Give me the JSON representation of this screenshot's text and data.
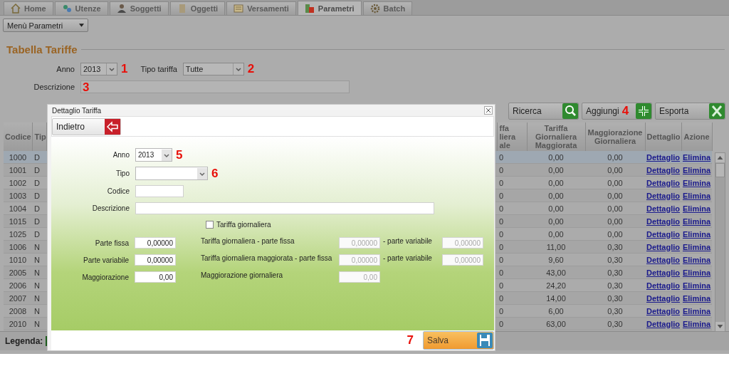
{
  "tabs": [
    {
      "label": "Home",
      "selected": false
    },
    {
      "label": "Utenze",
      "selected": false
    },
    {
      "label": "Soggetti",
      "selected": false
    },
    {
      "label": "Oggetti",
      "selected": false
    },
    {
      "label": "Versamenti",
      "selected": false
    },
    {
      "label": "Parametri",
      "selected": true
    },
    {
      "label": "Batch",
      "selected": false
    }
  ],
  "menu": {
    "value": "Menù Parametri"
  },
  "page_title": "Tabella Tariffe",
  "filters": {
    "anno": {
      "label": "Anno",
      "value": "2013",
      "marker": "1"
    },
    "tipo": {
      "label": "Tipo tariffa",
      "value": "Tutte",
      "marker": "2"
    },
    "descrizione": {
      "label": "Descrizione",
      "marker": "3"
    }
  },
  "actions": [
    {
      "label": "Ricerca",
      "kind": "search"
    },
    {
      "label": "Aggiungi",
      "kind": "add",
      "marker": "4"
    },
    {
      "label": "Esporta",
      "kind": "excel"
    }
  ],
  "table": {
    "columns": [
      "Codice",
      "Tip",
      "ffa liera ale",
      "Tariffa Giornaliera Maggiorata",
      "Maggiorazione Giornaliera",
      "Dettaglio",
      "Azione"
    ],
    "rows": [
      {
        "codice": "1000",
        "tipo": "D",
        "column_3": "0",
        "maggiorata": "0,00",
        "maggiorazione": "0,00",
        "detail_link": "Dettaglio",
        "action_link": "Elimina",
        "selected": true
      },
      {
        "codice": "1001",
        "tipo": "D",
        "column_3": "0",
        "maggiorata": "0,00",
        "maggiorazione": "0,00",
        "detail_link": "Dettaglio",
        "action_link": "Elimina",
        "selected": false
      },
      {
        "codice": "1002",
        "tipo": "D",
        "column_3": "0",
        "maggiorata": "0,00",
        "maggiorazione": "0,00",
        "detail_link": "Dettaglio",
        "action_link": "Elimina",
        "selected": false
      },
      {
        "codice": "1003",
        "tipo": "D",
        "column_3": "0",
        "maggiorata": "0,00",
        "maggiorazione": "0,00",
        "detail_link": "Dettaglio",
        "action_link": "Elimina",
        "selected": false
      },
      {
        "codice": "1004",
        "tipo": "D",
        "column_3": "0",
        "maggiorata": "0,00",
        "maggiorazione": "0,00",
        "detail_link": "Dettaglio",
        "action_link": "Elimina",
        "selected": false
      },
      {
        "codice": "1015",
        "tipo": "D",
        "column_3": "0",
        "maggiorata": "0,00",
        "maggiorazione": "0,00",
        "detail_link": "Dettaglio",
        "action_link": "Elimina",
        "selected": false
      },
      {
        "codice": "1025",
        "tipo": "D",
        "column_3": "0",
        "maggiorata": "0,00",
        "maggiorazione": "0,00",
        "detail_link": "Dettaglio",
        "action_link": "Elimina",
        "selected": false
      },
      {
        "codice": "1006",
        "tipo": "N",
        "column_3": "0",
        "maggiorata": "11,00",
        "maggiorazione": "0,30",
        "detail_link": "Dettaglio",
        "action_link": "Elimina",
        "selected": false
      },
      {
        "codice": "1010",
        "tipo": "N",
        "column_3": "0",
        "maggiorata": "9,60",
        "maggiorazione": "0,30",
        "detail_link": "Dettaglio",
        "action_link": "Elimina",
        "selected": false
      },
      {
        "codice": "2005",
        "tipo": "N",
        "column_3": "0",
        "maggiorata": "43,00",
        "maggiorazione": "0,30",
        "detail_link": "Dettaglio",
        "action_link": "Elimina",
        "selected": false
      },
      {
        "codice": "2006",
        "tipo": "N",
        "column_3": "0",
        "maggiorata": "24,20",
        "maggiorazione": "0,30",
        "detail_link": "Dettaglio",
        "action_link": "Elimina",
        "selected": false
      },
      {
        "codice": "2007",
        "tipo": "N",
        "column_3": "0",
        "maggiorata": "14,00",
        "maggiorazione": "0,30",
        "detail_link": "Dettaglio",
        "action_link": "Elimina",
        "selected": false
      },
      {
        "codice": "2008",
        "tipo": "N",
        "column_3": "0",
        "maggiorata": "6,00",
        "maggiorazione": "0,30",
        "detail_link": "Dettaglio",
        "action_link": "Elimina",
        "selected": false
      },
      {
        "codice": "2010",
        "tipo": "N",
        "column_3": "0",
        "maggiorata": "63,00",
        "maggiorazione": "0,30",
        "detail_link": "Dettaglio",
        "action_link": "Elimina",
        "selected": false
      }
    ]
  },
  "legend": {
    "label": "Legenda:"
  },
  "dialog": {
    "title": "Dettaglio Tariffa",
    "back_button": "Indietro",
    "fields": [
      {
        "label": "Anno",
        "kind": "select",
        "value": "2013",
        "marker": "5"
      },
      {
        "label": "Tipo",
        "kind": "select",
        "marker": "6"
      },
      {
        "label": "Codice",
        "kind": "text"
      },
      {
        "label": "Descrizione",
        "kind": "text"
      }
    ],
    "checkbox": {
      "label": "Tariffa giornaliera",
      "checked": false
    },
    "amount_rows": [
      {
        "label": "Parte fissa",
        "value": "0,00000",
        "daily_label": "Tariffa giornaliera - parte fissa",
        "daily_value": "0,00000",
        "daily_disabled": true,
        "variable_label": "- parte variabile",
        "variable_value": "0,00000"
      },
      {
        "label": "Parte variabile",
        "value": "0,00000",
        "daily_label": "Tariffa giornaliera maggiorata - parte fissa",
        "daily_value": "0,00000",
        "daily_disabled": true,
        "variable_label": "- parte variabile",
        "variable_value": "0,00000"
      },
      {
        "label": "Maggiorazione",
        "value": "0,00",
        "daily_label": "Maggiorazione giornaliera",
        "daily_value": "0,00",
        "daily_disabled": true
      }
    ],
    "save_button": "Salva",
    "save_marker": "7"
  }
}
